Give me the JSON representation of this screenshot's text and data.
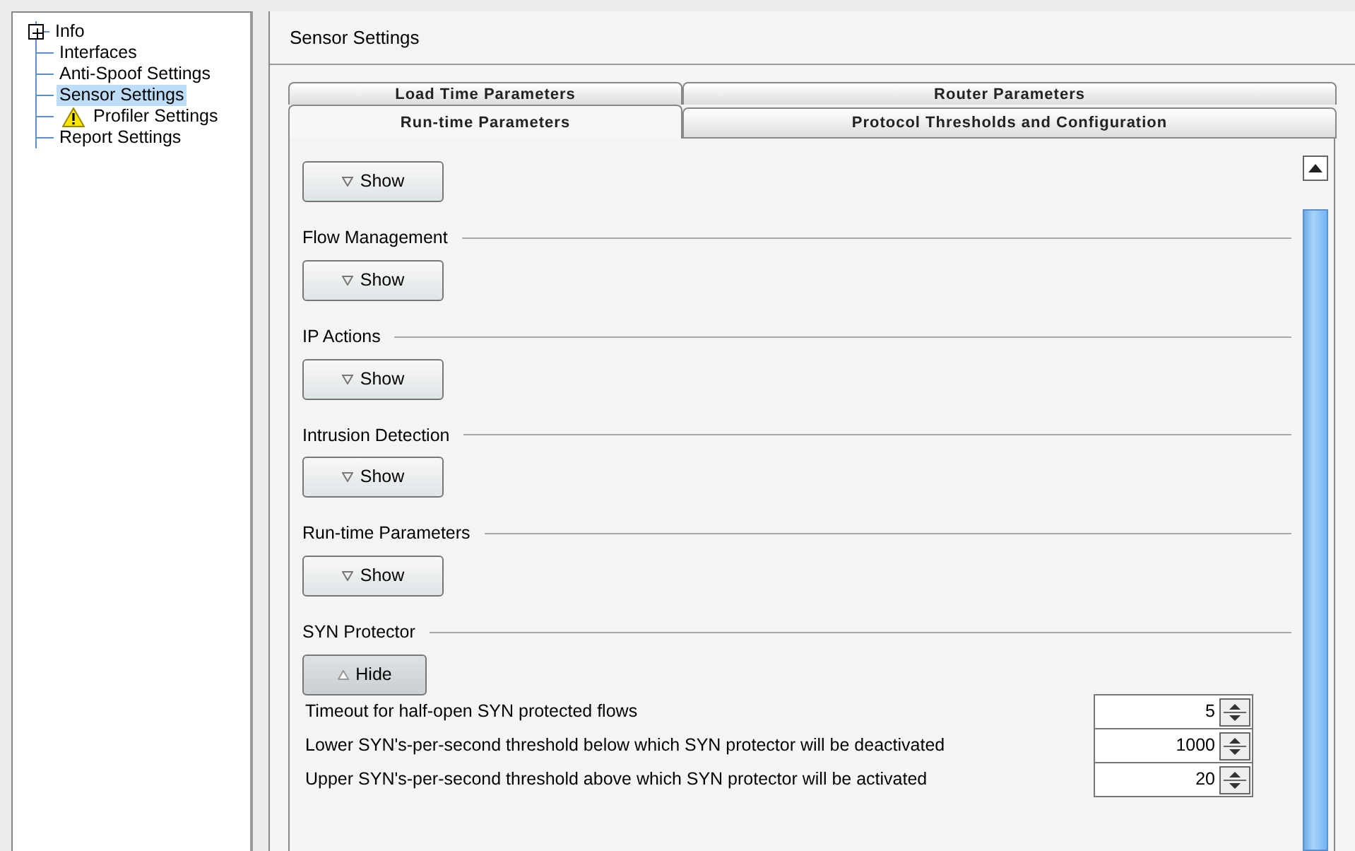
{
  "tree": {
    "items": [
      {
        "label": "Info",
        "kind": "expandable",
        "expanded": false,
        "selected": false
      },
      {
        "label": "Interfaces",
        "kind": "plain",
        "selected": false
      },
      {
        "label": "Anti-Spoof Settings",
        "kind": "plain",
        "selected": false
      },
      {
        "label": "Sensor Settings",
        "kind": "plain",
        "selected": true
      },
      {
        "label": "Profiler Settings",
        "kind": "warning",
        "selected": false
      },
      {
        "label": "Report Settings",
        "kind": "plain",
        "selected": false
      }
    ]
  },
  "panel": {
    "title": "Sensor Settings"
  },
  "tabs": {
    "rows": [
      [
        {
          "label": "Load Time Parameters",
          "selected": false
        },
        {
          "label": "Router Parameters",
          "selected": false
        }
      ],
      [
        {
          "label": "Run-time Parameters",
          "selected": true
        },
        {
          "label": "Protocol Thresholds and Configuration",
          "selected": false
        }
      ]
    ]
  },
  "sections": [
    {
      "button": {
        "label": "Show",
        "expanded": false
      }
    },
    {
      "title": "Flow Management",
      "button": {
        "label": "Show",
        "expanded": false
      }
    },
    {
      "title": "IP Actions",
      "button": {
        "label": "Show",
        "expanded": false
      }
    },
    {
      "title": "Intrusion Detection",
      "button": {
        "label": "Show",
        "expanded": false
      }
    },
    {
      "title": "Run-time Parameters",
      "button": {
        "label": "Show",
        "expanded": false
      }
    },
    {
      "title": "SYN Protector",
      "button": {
        "label": "Hide",
        "expanded": true
      },
      "fields": [
        {
          "label": "Timeout for half-open SYN protected flows",
          "value": "5"
        },
        {
          "label": "Lower SYN's-per-second threshold below which SYN protector will be deactivated",
          "value": "1000"
        },
        {
          "label": "Upper SYN's-per-second threshold above which SYN protector will be activated",
          "value": "20"
        }
      ]
    }
  ]
}
